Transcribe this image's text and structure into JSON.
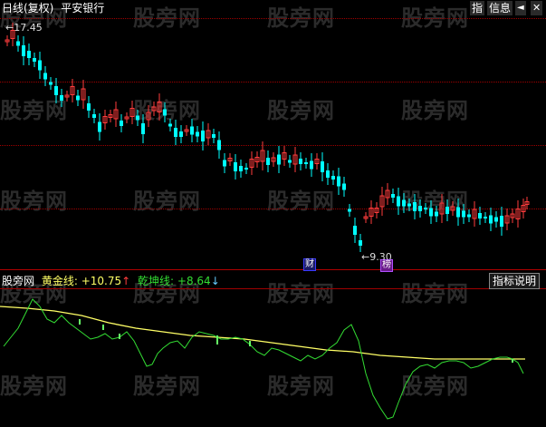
{
  "header": {
    "title": "日线(复权)",
    "stock_name": "平安银行",
    "btn_index": "指",
    "btn_info": "信息",
    "btn_back": "◄",
    "btn_close": "✕"
  },
  "price_chart": {
    "high_label": "17.45",
    "low_label": "9.30",
    "badge_cai": "财",
    "badge_bang": "榜"
  },
  "indicator": {
    "name": "股旁网",
    "gold_label": "黄金线:",
    "gold_value": "+10.75",
    "gold_arrow": "↑",
    "qk_label": "乾坤线:",
    "qk_value": "+8.64",
    "qk_arrow": "↓",
    "help_button": "指标说明"
  },
  "watermark": "股旁网",
  "colors": {
    "up": "#ff3c3c",
    "down": "#00ffff",
    "gold": "#ffff66",
    "qk": "#33dd33",
    "grid": "#8b0000"
  }
}
